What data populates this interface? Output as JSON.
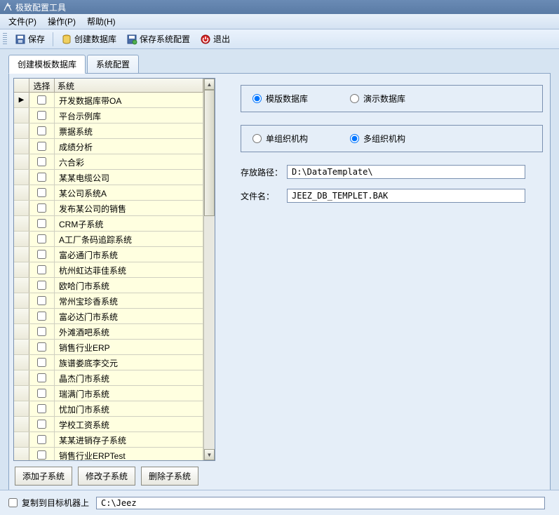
{
  "titlebar": {
    "title": "极致配置工具"
  },
  "menubar": {
    "file": "文件(P)",
    "operate": "操作(P)",
    "help": "帮助(H)"
  },
  "toolbar": {
    "save": "保存",
    "create_db": "创建数据库",
    "save_sys_cfg": "保存系统配置",
    "exit": "退出"
  },
  "tabs": {
    "tab1": "创建模板数据库",
    "tab2": "系统配置"
  },
  "grid": {
    "col_select": "选择",
    "col_system": "系统",
    "rows": [
      {
        "label": "开发数据库带OA",
        "pointer": true
      },
      {
        "label": "平台示例库"
      },
      {
        "label": "票据系统"
      },
      {
        "label": "成绩分析"
      },
      {
        "label": "六合彩"
      },
      {
        "label": "某某电缆公司"
      },
      {
        "label": "某公司系统A"
      },
      {
        "label": "发布某公司的销售"
      },
      {
        "label": "CRM子系统"
      },
      {
        "label": "A工厂条码追踪系统"
      },
      {
        "label": "富必通门市系统"
      },
      {
        "label": "杭州虹达菲佳系统"
      },
      {
        "label": "欧哈门市系统"
      },
      {
        "label": "常州宝珍香系统"
      },
      {
        "label": "富必达门市系统"
      },
      {
        "label": "外滩酒吧系统"
      },
      {
        "label": "销售行业ERP"
      },
      {
        "label": "族谱娄底李交元"
      },
      {
        "label": "晶杰门市系统"
      },
      {
        "label": "瑞满门市系统"
      },
      {
        "label": "忧加门市系统"
      },
      {
        "label": "学校工资系统"
      },
      {
        "label": "某某进销存子系统"
      },
      {
        "label": "销售行业ERPTest"
      }
    ]
  },
  "sub_buttons": {
    "add": "添加子系统",
    "edit": "修改子系统",
    "delete": "删除子系统"
  },
  "right": {
    "db_type": {
      "template": "模版数据库",
      "demo": "演示数据库"
    },
    "org_type": {
      "single": "单组织机构",
      "multi": "多组织机构"
    },
    "path_label": "存放路径：",
    "path_value": "D:\\DataTemplate\\",
    "file_label": "文件名：",
    "file_value": "JEEZ_DB_TEMPLET.BAK"
  },
  "bottom": {
    "copy_label": "复制到目标机器上",
    "path_value": "C:\\Jeez"
  }
}
